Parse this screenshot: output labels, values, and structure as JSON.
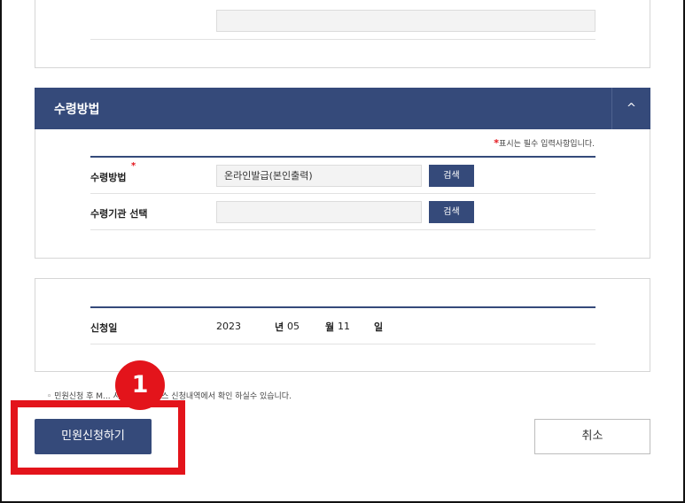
{
  "receive_panel": {
    "title": "수령방법",
    "toggle_icon": "chevron-up-icon",
    "toggle_glyph": "^",
    "required_marker": "*",
    "required_note": "표시는 필수 입력사항입니다.",
    "rows": [
      {
        "label": "수령방법",
        "required_marker": "*",
        "value": "온라인발급(본인출력)",
        "button": "검색"
      },
      {
        "label": "수령기관 선택",
        "value": "",
        "button": "검색"
      }
    ]
  },
  "date_panel": {
    "label": "신청일",
    "year": "2023",
    "year_unit": "년",
    "month": "05",
    "month_unit": "월",
    "day": "11",
    "day_unit": "일"
  },
  "notice": "◦ 민원신청 후 M... 서비스 > 서비스 신청내역에서 확인 하실수 있습니다.",
  "actions": {
    "submit_label": "민원신청하기",
    "cancel_label": "취소"
  },
  "annotation": {
    "step_number": "1",
    "color": "#e3141b"
  },
  "colors": {
    "primary": "#354a7a",
    "required": "#e3141b"
  }
}
